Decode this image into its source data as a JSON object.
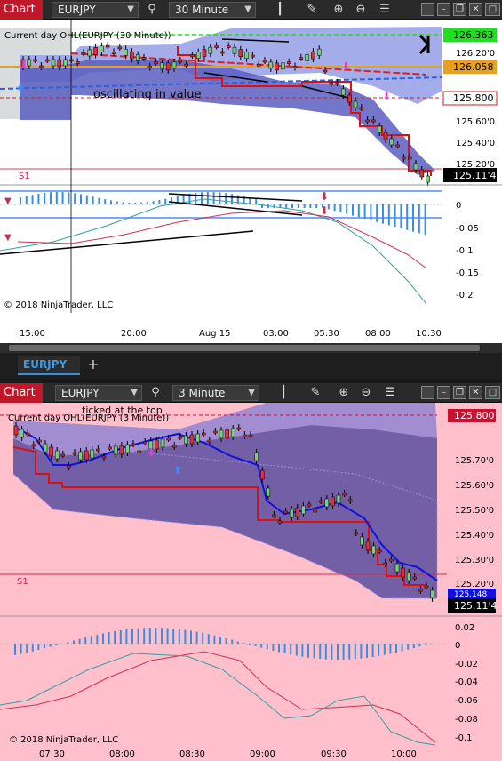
{
  "top": {
    "brand": "Chart",
    "instrument": "EURJPY",
    "timeframe": "30 Minute",
    "indicator_label": "Current day OHL(EURJPY (30 Minute))",
    "annotation": "oscillating in value",
    "s1_label": "S1",
    "price_badges": {
      "green": "126.363",
      "orange": "126.058",
      "red": "125.800",
      "last": "125.11'4"
    },
    "price_axis": [
      "126.20'0",
      "125.60'0",
      "125.40'0",
      "125.20'0"
    ],
    "osc_axis": [
      "0",
      "-0.05",
      "-0.1",
      "-0.15",
      "-0.2"
    ],
    "time_axis": [
      "15:00",
      "20:00",
      "Aug 15",
      "03:00",
      "05:30",
      "08:00",
      "10:30"
    ],
    "copyright": "© 2018 NinjaTrader, LLC",
    "tab_label": "EURJPY",
    "add_tab": "+"
  },
  "bottom": {
    "brand": "Chart",
    "instrument": "EURJPY",
    "timeframe": "3 Minute",
    "indicator_label": "Current day OHL(EURJPY (3 Minute))",
    "annotation": "ticked at the top",
    "s1_label": "S1",
    "price_badges": {
      "red": "125.800",
      "blue": "125.148",
      "last": "125.11'4"
    },
    "price_axis": [
      "125.70'0",
      "125.60'0",
      "125.50'0",
      "125.40'0",
      "125.30'0",
      "125.20'0"
    ],
    "osc_axis": [
      "0.02",
      "0",
      "-0.02",
      "-0.04",
      "-0.06",
      "-0.08",
      "-0.1"
    ],
    "time_axis": [
      "07:30",
      "08:00",
      "08:30",
      "09:00",
      "09:30",
      "10:00"
    ],
    "copyright": "© 2018 NinjaTrader, LLC"
  },
  "colors": {
    "brand": "#c0182a",
    "bottom_bg": "#ffc0cb",
    "band": "#5050b0",
    "up": "#7ad07a",
    "down": "#e03030"
  }
}
